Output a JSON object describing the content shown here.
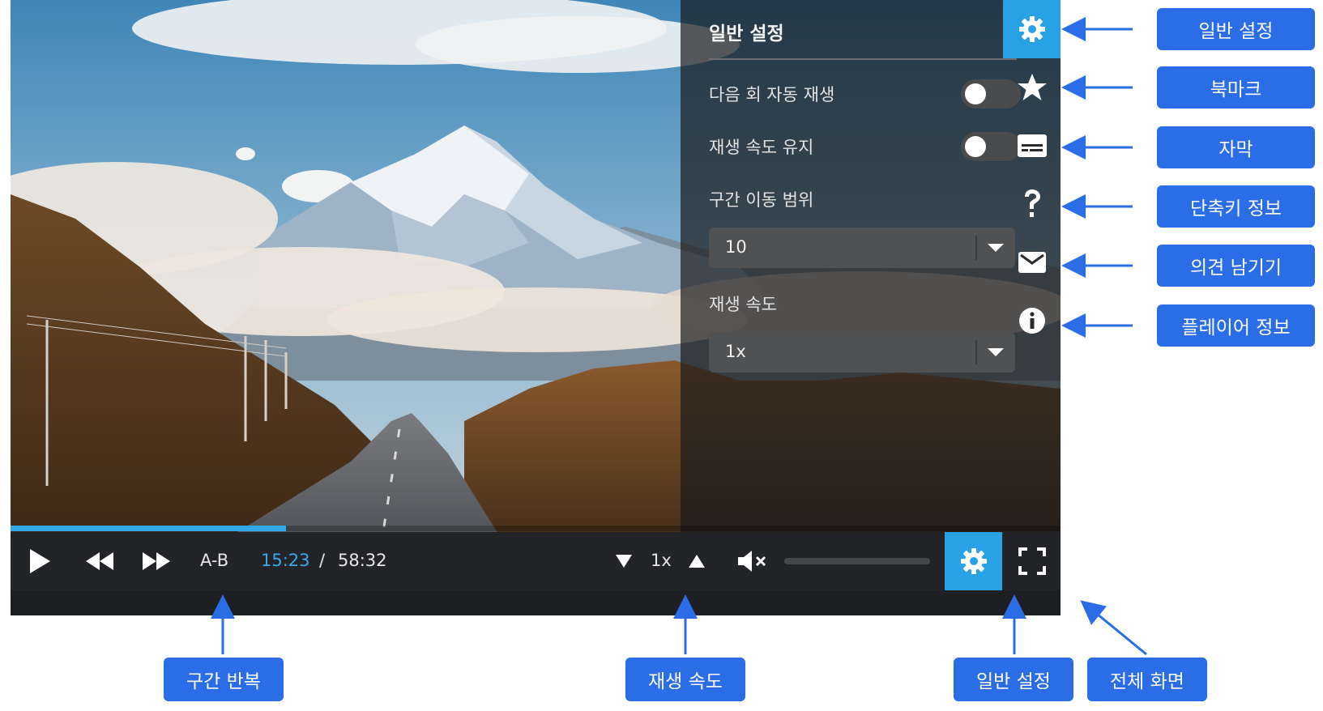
{
  "settings": {
    "title": "일반 설정",
    "auto_next_label": "다음 회 자동 재생",
    "auto_next_on": false,
    "keep_speed_label": "재생 속도 유지",
    "keep_speed_on": false,
    "seek_range_label": "구간 이동 범위",
    "seek_range_value": "10",
    "speed_label": "재생 속도",
    "speed_value": "1x"
  },
  "side_menu": [
    {
      "icon": "gear-icon",
      "active": true
    },
    {
      "icon": "star-icon",
      "active": false
    },
    {
      "icon": "subtitles-icon",
      "active": false
    },
    {
      "icon": "question-icon",
      "active": false
    },
    {
      "icon": "mail-icon",
      "active": false
    },
    {
      "icon": "info-icon",
      "active": false
    }
  ],
  "controls": {
    "ab_label": "A-B",
    "current_time": "15:23",
    "separator": "/",
    "duration": "58:32",
    "speed": "1x",
    "progress_fraction": 0.262,
    "volume_muted": true
  },
  "callouts": {
    "general_settings": "일반 설정",
    "bookmark": "북마크",
    "subtitles": "자막",
    "shortcuts": "단축키 정보",
    "feedback": "의견 남기기",
    "player_info": "플레이어 정보",
    "ab_repeat": "구간 반복",
    "playback_speed": "재생 속도",
    "general_settings_bottom": "일반 설정",
    "fullscreen": "전체 화면"
  },
  "colors": {
    "accent": "#29a1e6",
    "progress": "#2ea8ea",
    "callout": "#2b6de6",
    "control_bar": "#232427"
  }
}
